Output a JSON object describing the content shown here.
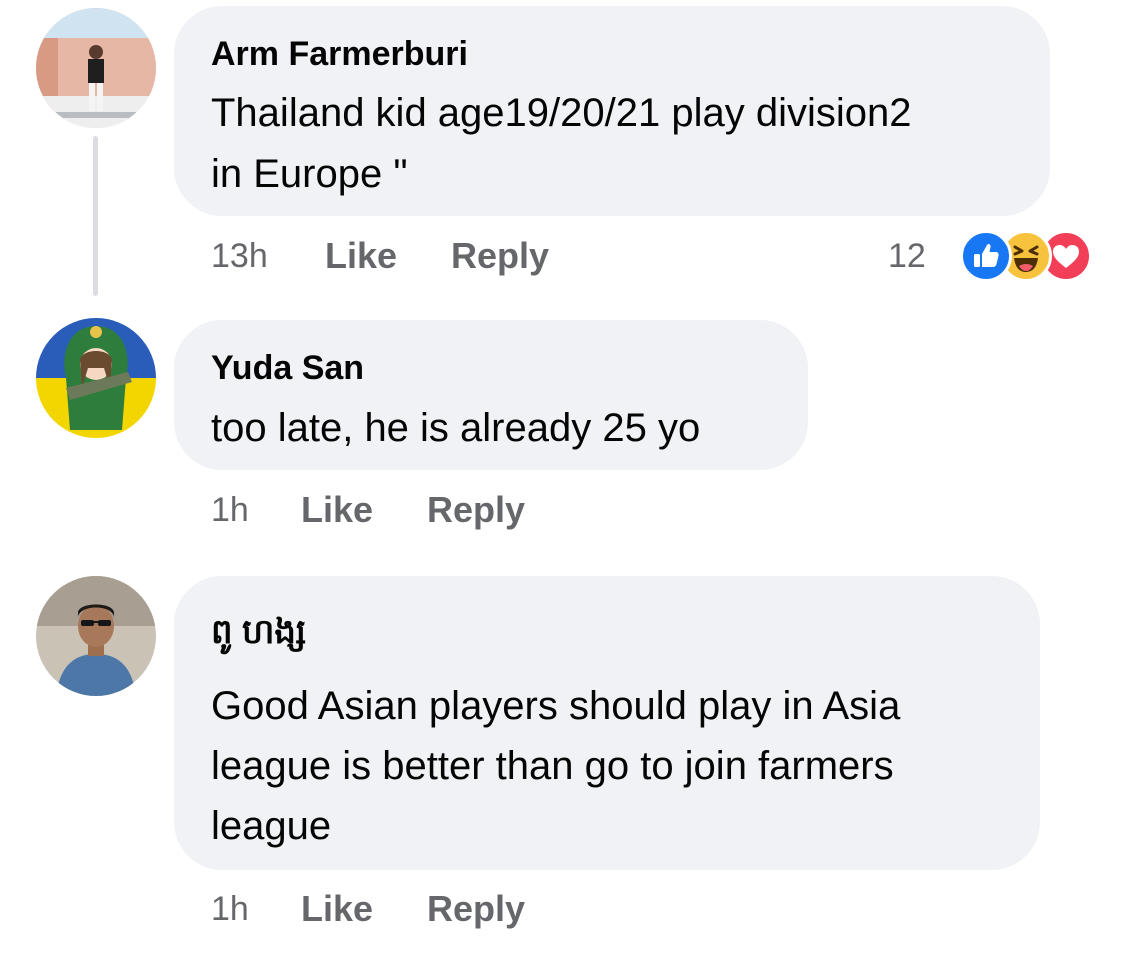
{
  "comments": [
    {
      "author": "Arm Farmerburi",
      "text_lines": [
        "Thailand kid age19/20/21 play division2",
        "in Europe \""
      ],
      "time": "13h",
      "like_label": "Like",
      "reply_label": "Reply",
      "reactions": {
        "count": "12",
        "icons": [
          "like-reaction-icon",
          "haha-reaction-icon",
          "love-reaction-icon"
        ]
      }
    },
    {
      "author": "Yuda San",
      "text_lines": [
        "too late, he is already 25 yo"
      ],
      "time": "1h",
      "like_label": "Like",
      "reply_label": "Reply"
    },
    {
      "author": "ពូ ហង្ស",
      "text_lines": [
        "Good Asian players should play in Asia",
        "league is better than go to join farmers",
        "league"
      ],
      "time": "1h",
      "like_label": "Like",
      "reply_label": "Reply"
    }
  ],
  "colors": {
    "bubble": "#f0f2f5",
    "meta_text": "#65676b",
    "like_blue": "#1877f2",
    "haha_yellow": "#f7c33d",
    "love_red": "#f33e58"
  }
}
